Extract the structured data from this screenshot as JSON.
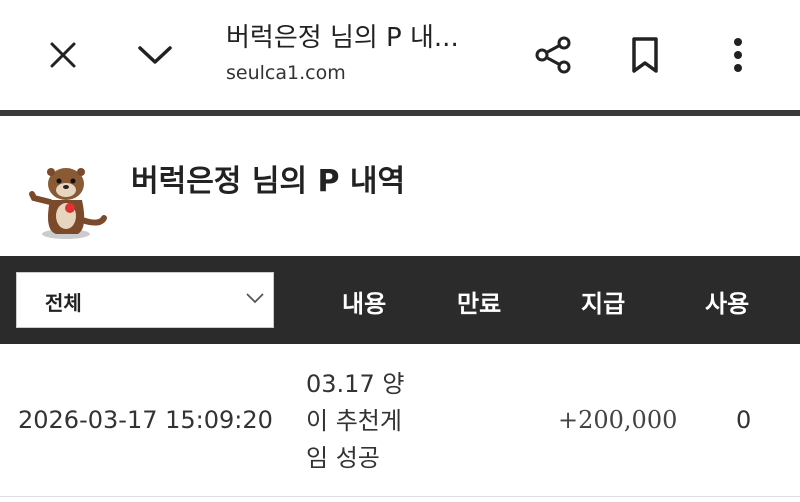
{
  "browser": {
    "title": "버럭은정 님의 P 내...",
    "url": "seulca1.com",
    "icons": {
      "close": "close-icon",
      "collapse": "chevron-down-icon",
      "share": "share-icon",
      "bookmark": "bookmark-icon",
      "more": "more-vert-icon"
    }
  },
  "page": {
    "heading": "버럭은정 님의 P 내역"
  },
  "table": {
    "filter": {
      "selected": "전체"
    },
    "columns": [
      "내용",
      "만료",
      "지급",
      "사용"
    ],
    "rows": [
      {
        "datetime": "2026-03-17 15:09:20",
        "content": "03.17 양이 추천게임 성공",
        "expiry": "",
        "grant": "+200,000",
        "use": "0"
      }
    ]
  },
  "colors": {
    "header_bg": "#2b2b2b",
    "divider": "#3a3a3a",
    "text": "#222222"
  }
}
